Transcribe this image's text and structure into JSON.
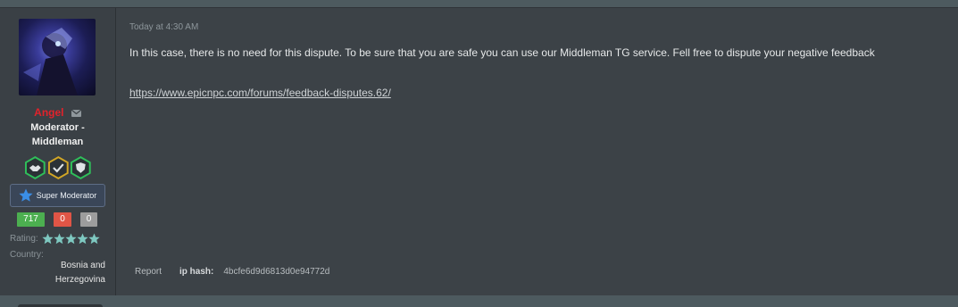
{
  "user": {
    "name": "Angel",
    "title_line1": "Moderator -",
    "title_line2": "Middleman",
    "staff_badge": "Super Moderator",
    "feedback": {
      "positive": "717",
      "negative": "0",
      "neutral": "0"
    },
    "rating_label": "Rating:",
    "rating_stars": 5,
    "country_label": "Country:",
    "country_line1": "Bosnia and",
    "country_line2": "Herzegovina",
    "badge_icons": [
      "handshake-icon",
      "checkmark-icon",
      "shield-icon"
    ]
  },
  "post": {
    "timestamp": "Today at 4:30 AM",
    "message": "In this case, there is no need for this dispute. To be sure that you are safe you can use our Middleman TG service. Fell free to dispute your negative feedback",
    "link": "https://www.epicnpc.com/forums/feedback-disputes.62/"
  },
  "footer": {
    "report_label": "Report",
    "ip_label": "ip hash:",
    "ip_value": "4bcfe6d9d6813d0e94772d"
  },
  "colors": {
    "name": "#e2222b",
    "positive": "#4caf50",
    "negative": "#e05546",
    "neutral": "#9d9d9d",
    "star": "#7ec8c0"
  }
}
